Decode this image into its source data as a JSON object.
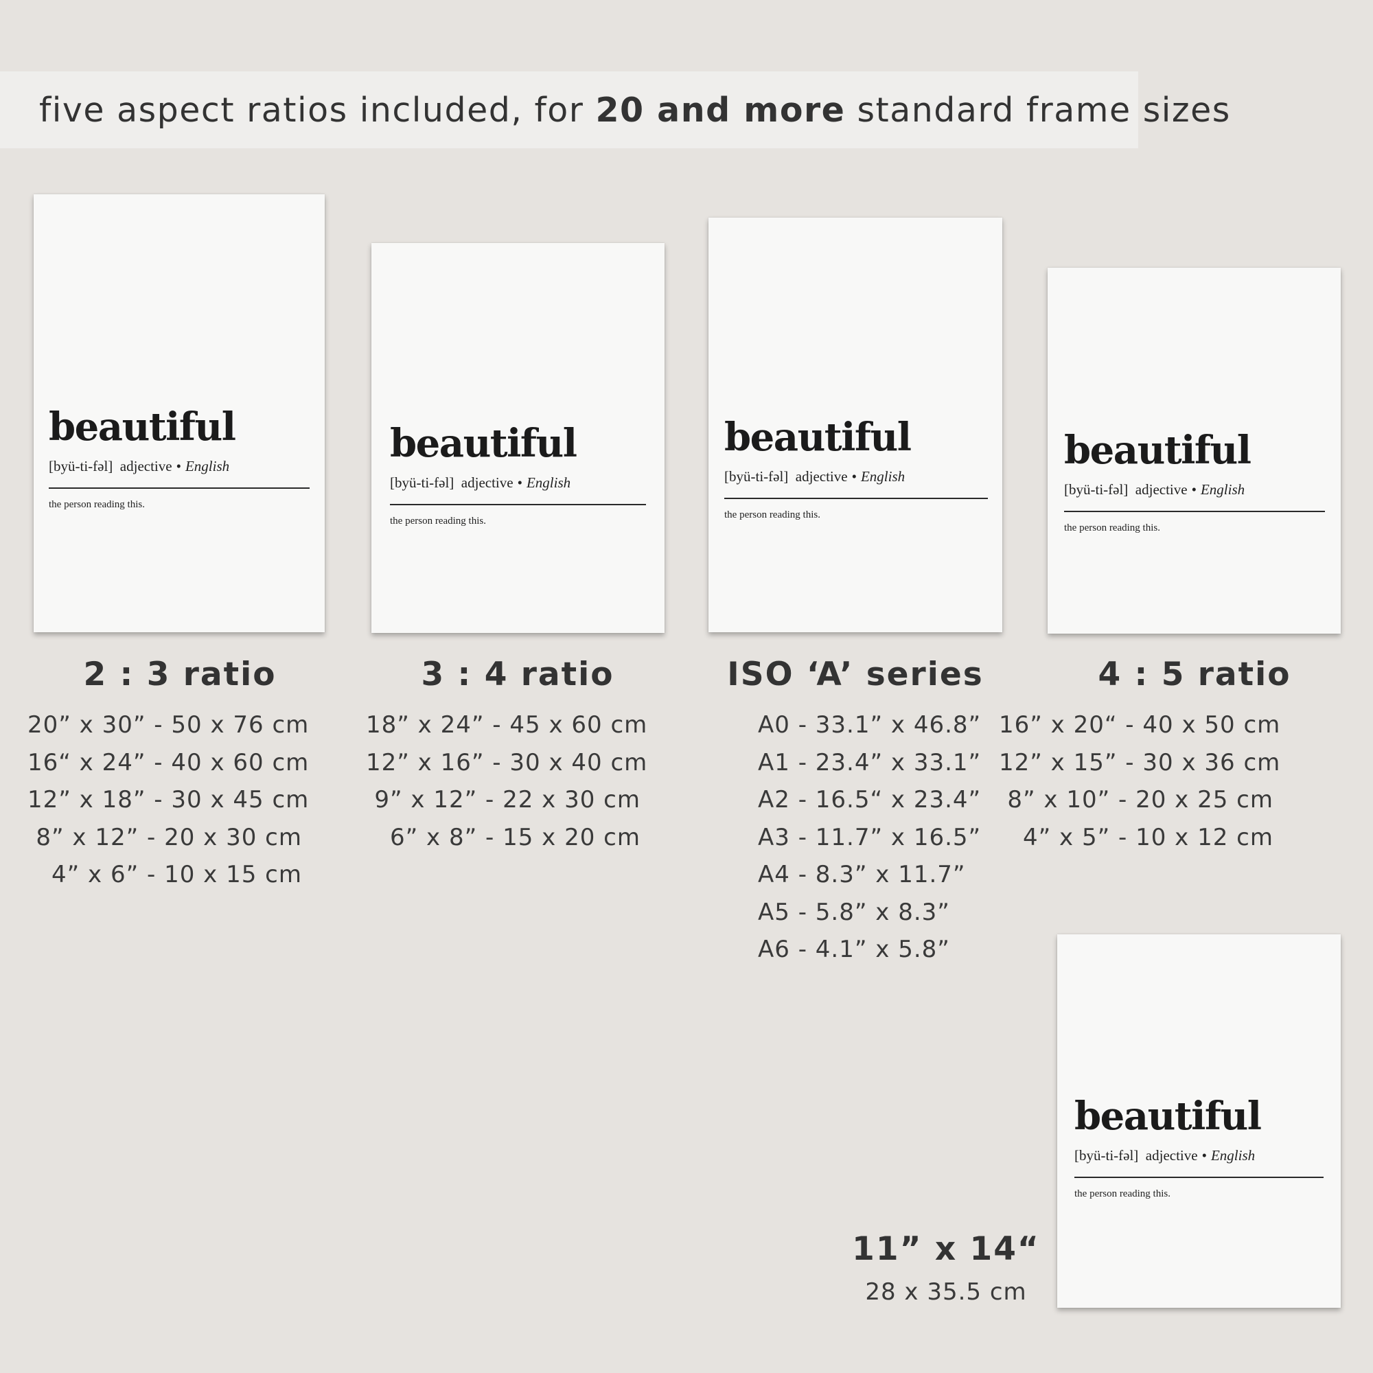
{
  "banner": {
    "prefix": "five aspect ratios included, for ",
    "highlight": "20 and more",
    "suffix": " standard frame sizes"
  },
  "print": {
    "word": "beautiful",
    "pronunciation": "[byü-ti-fəl]",
    "part_of_speech": "adjective",
    "separator": "•",
    "language": "English",
    "definition": "the person reading this."
  },
  "groups": [
    {
      "title": "2 : 3 ratio",
      "sizes": [
        "20” x 30” - 50 x 76 cm",
        "16“ x 24” - 40 x 60 cm",
        "12” x 18” - 30 x 45 cm",
        "8” x 12” - 20 x 30 cm",
        "4” x 6” - 10 x 15 cm"
      ]
    },
    {
      "title": "3 : 4 ratio",
      "sizes": [
        "18” x 24” - 45 x 60 cm",
        "12” x 16” - 30 x 40 cm",
        "9” x 12” - 22 x 30 cm",
        "6” x 8” - 15 x 20 cm"
      ]
    },
    {
      "title": "ISO ‘A’ series",
      "sizes": [
        "A0 - 33.1” x 46.8”",
        "A1 - 23.4” x 33.1”",
        "A2 - 16.5“ x 23.4”",
        "A3 - 11.7” x 16.5”",
        "A4 - 8.3” x 11.7”",
        "A5 - 5.8” x 8.3”",
        "A6 - 4.1” x 5.8”"
      ]
    },
    {
      "title": "4 : 5 ratio",
      "sizes": [
        "16” x 20“ - 40 x 50 cm",
        "12” x 15” - 30 x 36 cm",
        "8” x 10” - 20 x 25 cm",
        "4” x 5” - 10 x 12 cm"
      ]
    },
    {
      "title": "11” x 14“",
      "sizes": [
        "28 x 35.5 cm"
      ]
    }
  ]
}
